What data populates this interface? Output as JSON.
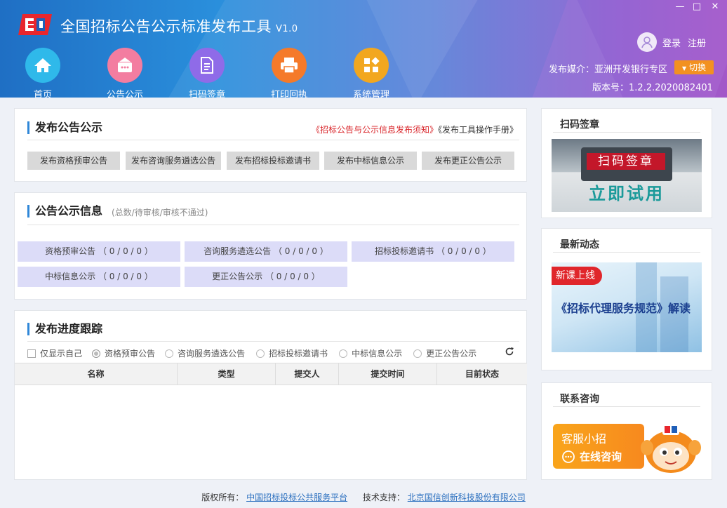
{
  "app": {
    "title": "全国招标公告公示标准发布工具",
    "version": "V1.0"
  },
  "window_controls": {
    "minimize": "—",
    "maximize": "□",
    "close": "✕"
  },
  "nav": [
    {
      "label": "首页",
      "icon": "home-icon",
      "color": "#2fb9ea"
    },
    {
      "label": "公告公示",
      "icon": "bulletin-icon",
      "color": "#f37da0"
    },
    {
      "label": "扫码签章",
      "icon": "document-icon",
      "color": "#8f6be8"
    },
    {
      "label": "打印回执",
      "icon": "printer-icon",
      "color": "#f57a2a"
    },
    {
      "label": "系统管理",
      "icon": "apps-icon",
      "color": "#f2a71f"
    }
  ],
  "user": {
    "login": "登录",
    "register": "注册"
  },
  "media": {
    "label": "发布媒介：",
    "value": "亚洲开发银行专区",
    "switch": "切换"
  },
  "version_line": {
    "label": "版本号：",
    "value": "1.2.2.2020082401"
  },
  "publish_panel": {
    "title": "发布公告公示",
    "link1": "《招标公告与公示信息发布须知》",
    "link2": "《发布工具操作手册》",
    "buttons": [
      "发布资格预审公告",
      "发布咨询服务遴选公告",
      "发布招标投标邀请书",
      "发布中标信息公示",
      "发布更正公告公示"
    ]
  },
  "info_panel": {
    "title": "公告公示信息",
    "subtitle": "(总数/待审核/审核不通过)",
    "stats": [
      "资格预审公告 （ 0 / 0 / 0 ）",
      "咨询服务遴选公告 （ 0 / 0 / 0 ）",
      "招标投标邀请书 （ 0 / 0 / 0 ）",
      "中标信息公示 （ 0 / 0 / 0 ）",
      "更正公告公示 （ 0 / 0 / 0 ）"
    ]
  },
  "progress_panel": {
    "title": "发布进度跟踪",
    "only_self": "仅显示自己",
    "filters": [
      "资格预审公告",
      "咨询服务遴选公告",
      "招标投标邀请书",
      "中标信息公示",
      "更正公告公示"
    ],
    "selected_filter": 0,
    "columns": [
      "名称",
      "类型",
      "提交人",
      "提交时间",
      "目前状态"
    ],
    "rows": []
  },
  "side_scan": {
    "title": "扫码签章",
    "banner_top": "扫码签章",
    "banner_bottom": "立即试用"
  },
  "side_news": {
    "title": "最新动态",
    "badge": "新课上线",
    "headline": "《招标代理服务规范》解读"
  },
  "side_contact": {
    "title": "联系咨询",
    "line1": "客服小招",
    "line2": "在线咨询"
  },
  "footer": {
    "copyright_label": "版权所有：",
    "copyright_link": "中国招标投标公共服务平台",
    "support_label": "技术支持：",
    "support_link": "北京国信创新科技股份有限公司"
  },
  "colors": {
    "accent": "#2f87d8",
    "stat_bg": "#dcdcf8",
    "switch": "#f29121",
    "link_red": "#d9252a"
  }
}
